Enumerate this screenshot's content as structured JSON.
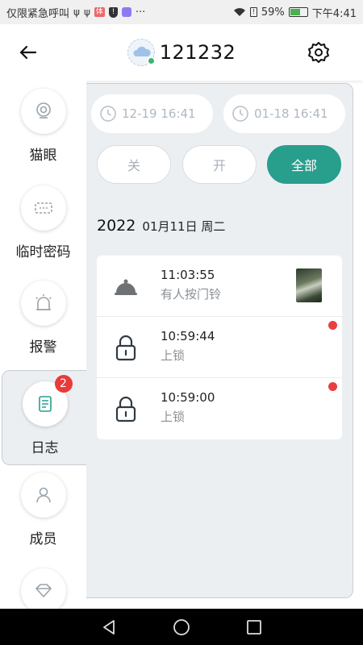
{
  "status_bar": {
    "left_text": "仅限紧急呼叫",
    "left_icons": [
      "usb-icon",
      "usb-icon",
      "notification-box-icon",
      "shield-icon",
      "app-icon"
    ],
    "box_text": "体",
    "more": "···",
    "battery_level": 59,
    "battery_text": "59%",
    "time": "下午4:41"
  },
  "header": {
    "title": "121232",
    "back_icon": "arrow-left-icon",
    "settings_icon": "gear-icon"
  },
  "sidebar": {
    "items": [
      {
        "label": "猫眼",
        "icon": "peephole-camera-icon"
      },
      {
        "label": "临时密码",
        "icon": "password-icon"
      },
      {
        "label": "报警",
        "icon": "alarm-icon"
      },
      {
        "label": "日志",
        "icon": "log-icon",
        "badge": "2",
        "active": true
      },
      {
        "label": "成员",
        "icon": "user-icon"
      },
      {
        "label": "",
        "icon": "diamond-icon"
      }
    ]
  },
  "filters": {
    "start_date": "12-19 16:41",
    "end_date": "01-18 16:41",
    "buttons": [
      {
        "label": "关",
        "active": false
      },
      {
        "label": "开",
        "active": false
      },
      {
        "label": "全部",
        "active": true
      }
    ]
  },
  "log_date": {
    "year": "2022",
    "date": "01月11日 周二"
  },
  "logs": [
    {
      "time": "11:03:55",
      "desc": "有人按门铃",
      "icon": "doorbell-icon",
      "has_thumb": true,
      "unread": false
    },
    {
      "time": "10:59:44",
      "desc": "上锁",
      "icon": "lock-icon",
      "has_thumb": false,
      "unread": true
    },
    {
      "time": "10:59:00",
      "desc": "上锁",
      "icon": "lock-icon",
      "has_thumb": false,
      "unread": true
    }
  ],
  "colors": {
    "accent": "#289e8d",
    "badge": "#e83a3a",
    "panel_bg": "#eceff2"
  }
}
